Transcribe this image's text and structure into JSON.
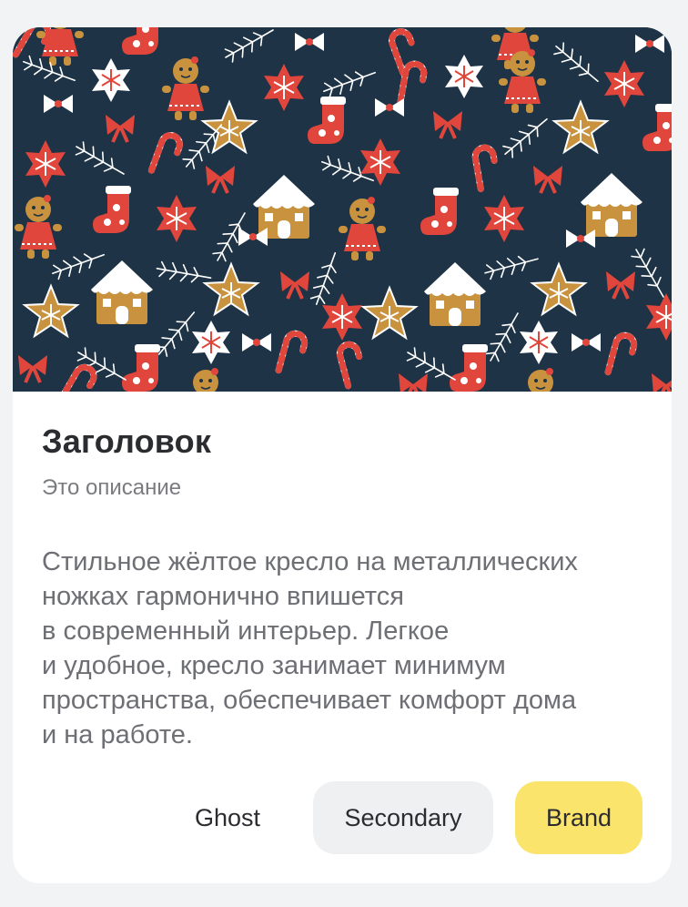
{
  "card": {
    "cover_image": "christmas-cookies-pattern",
    "cover_colors": {
      "background": "#1e3346",
      "red": "#e0463b",
      "white": "#ffffff",
      "gingerbread": "#c8923e",
      "pink": "#f2a5a0"
    },
    "title": "Заголовок",
    "subtitle": "Это описание",
    "description": "Стильное жёлтое кресло на металлических\nножках гармонично впишется\nв современный интерьер. Легкое\nи удобное, кресло занимает минимум\nпространства, обеспечивает комфорт дома\nи на работе."
  },
  "actions": {
    "ghost_label": "Ghost",
    "secondary_label": "Secondary",
    "brand_label": "Brand",
    "brand_color": "#fbe46b",
    "secondary_color": "#eff0f2"
  }
}
